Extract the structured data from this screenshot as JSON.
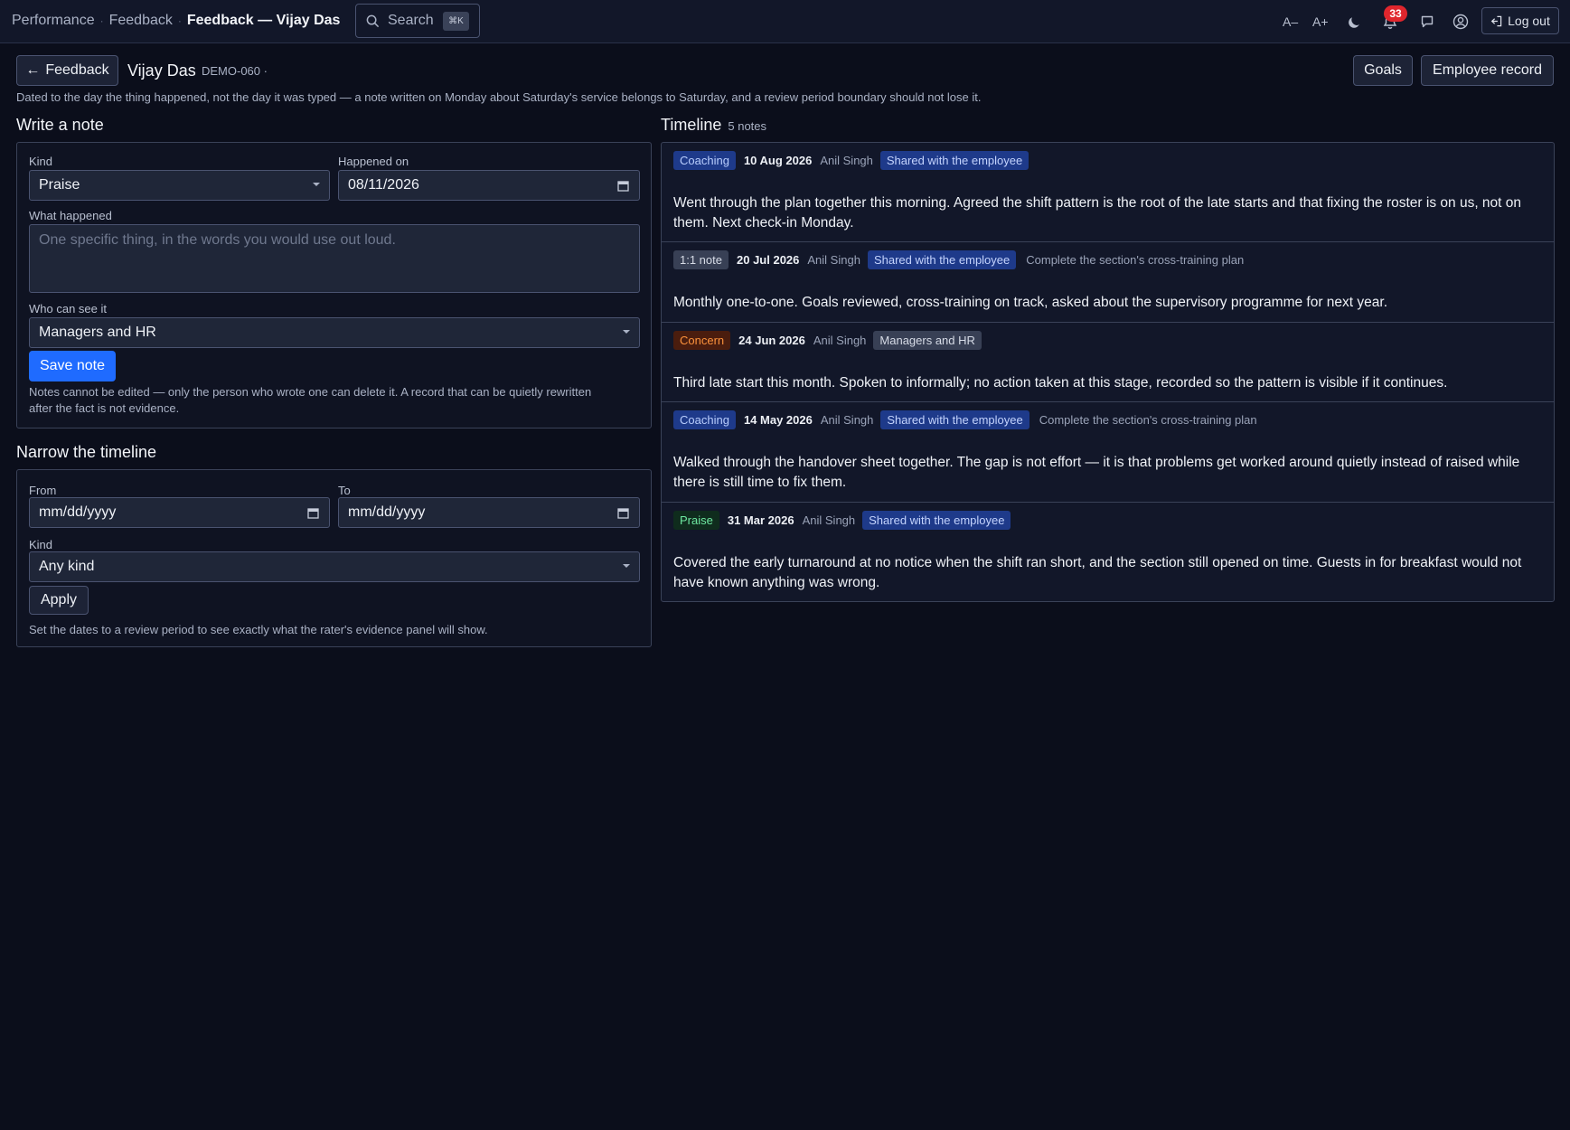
{
  "topbar": {
    "breadcrumbs": [
      "Performance",
      "Feedback",
      "Feedback — Vijay Das"
    ],
    "search_label": "Search",
    "search_shortcut": "⌘K",
    "font_decrease": "A–",
    "font_increase": "A+",
    "notification_count": "33",
    "logout_label": "Log out"
  },
  "header": {
    "back_label": "Feedback",
    "employee_name": "Vijay Das",
    "employee_id": "DEMO-060 ·",
    "goals_label": "Goals",
    "record_label": "Employee record",
    "subtitle": "Dated to the day the thing happened, not the day it was typed — a note written on Monday about Saturday's service belongs to Saturday, and a review period boundary should not lose it."
  },
  "write_note": {
    "title": "Write a note",
    "kind_label": "Kind",
    "kind_value": "Praise",
    "happened_label": "Happened on",
    "happened_value": "08/11/2026",
    "what_label": "What happened",
    "what_placeholder": "One specific thing, in the words you would use out loud.",
    "who_label": "Who can see it",
    "who_value": "Managers and HR",
    "save_label": "Save note",
    "hint": "Notes cannot be edited — only the person who wrote one can delete it. A record that can be quietly rewritten after the fact is not evidence."
  },
  "narrow": {
    "title": "Narrow the timeline",
    "from_label": "From",
    "from_value": "mm/dd/yyyy",
    "to_label": "To",
    "to_value": "mm/dd/yyyy",
    "kind_label": "Kind",
    "kind_value": "Any kind",
    "apply_label": "Apply",
    "hint": "Set the dates to a review period to see exactly what the rater's evidence panel will show."
  },
  "timeline": {
    "title": "Timeline",
    "count": "5 notes",
    "notes": [
      {
        "kind": "Coaching",
        "date": "10 Aug 2026",
        "author": "Anil Singh",
        "visibility": "Shared with the employee",
        "goal": "",
        "body": "Went through the plan together this morning. Agreed the shift pattern is the root of the late starts and that fixing the roster is on us, not on them. Next check-in Monday."
      },
      {
        "kind": "1:1 note",
        "date": "20 Jul 2026",
        "author": "Anil Singh",
        "visibility": "Shared with the employee",
        "goal": "Complete the section's cross-training plan",
        "body": "Monthly one-to-one. Goals reviewed, cross-training on track, asked about the supervisory programme for next year."
      },
      {
        "kind": "Concern",
        "date": "24 Jun 2026",
        "author": "Anil Singh",
        "visibility": "Managers and HR",
        "goal": "",
        "body": "Third late start this month. Spoken to informally; no action taken at this stage, recorded so the pattern is visible if it continues."
      },
      {
        "kind": "Coaching",
        "date": "14 May 2026",
        "author": "Anil Singh",
        "visibility": "Shared with the employee",
        "goal": "Complete the section's cross-training plan",
        "body": "Walked through the handover sheet together. The gap is not effort — it is that problems get worked around quietly instead of raised while there is still time to fix them."
      },
      {
        "kind": "Praise",
        "date": "31 Mar 2026",
        "author": "Anil Singh",
        "visibility": "Shared with the employee",
        "goal": "",
        "body": "Covered the early turnaround at no notice when the shift ran short, and the section still opened on time. Guests in for breakfast would not have known anything was wrong."
      }
    ]
  }
}
